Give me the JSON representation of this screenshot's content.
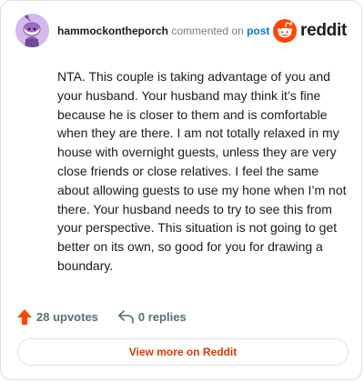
{
  "comment": {
    "author": "hammockontheporch",
    "action_text": "commented on",
    "link_text": "post",
    "body": "NTA. This couple is taking advantage of you and your husband. Your husband may think it’s fine because he is closer to them and is comfortable when they are there. I am not totally relaxed in my house with overnight guests, unless they are very close friends or close relatives. I feel the same about allowing guests to use my hone when I’m not there. Your husband needs to try to see this from your perspective. This situation is not going to get better on its own, so good for you for drawing a boundary."
  },
  "brand": {
    "wordmark": "reddit",
    "icon": "reddit-snoo-icon",
    "color": "#ff4500"
  },
  "footer": {
    "upvotes_label": "28 upvotes",
    "upvote_icon": "upvote-arrow-icon",
    "upvote_color": "#ff4500",
    "replies_label": "0 replies",
    "reply_icon": "reply-arrow-icon"
  },
  "cta": {
    "view_more_label": "View more on Reddit",
    "color": "#d93a00"
  },
  "colors": {
    "link": "#0079d3",
    "avatar_bg": "#d6b8ec",
    "border": "#dcdfe3"
  }
}
